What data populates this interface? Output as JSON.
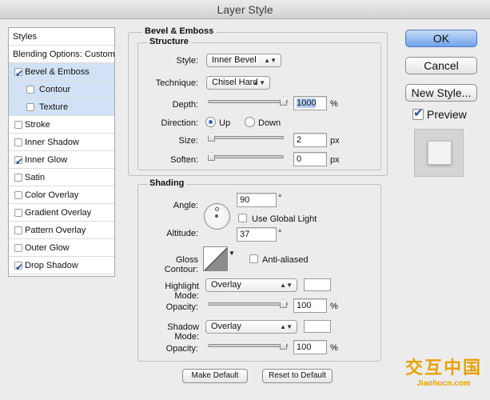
{
  "window": {
    "title": "Layer Style"
  },
  "left_panel": {
    "header": "Styles",
    "blending": "Blending Options: Custom",
    "items": [
      {
        "label": "Bevel & Emboss",
        "checked": true,
        "selected": true,
        "indent": false
      },
      {
        "label": "Contour",
        "checked": false,
        "selected": true,
        "indent": true
      },
      {
        "label": "Texture",
        "checked": false,
        "selected": true,
        "indent": true
      },
      {
        "label": "Stroke",
        "checked": false,
        "selected": false,
        "indent": false
      },
      {
        "label": "Inner Shadow",
        "checked": false,
        "selected": false,
        "indent": false
      },
      {
        "label": "Inner Glow",
        "checked": true,
        "selected": false,
        "indent": false
      },
      {
        "label": "Satin",
        "checked": false,
        "selected": false,
        "indent": false
      },
      {
        "label": "Color Overlay",
        "checked": false,
        "selected": false,
        "indent": false
      },
      {
        "label": "Gradient Overlay",
        "checked": false,
        "selected": false,
        "indent": false
      },
      {
        "label": "Pattern Overlay",
        "checked": false,
        "selected": false,
        "indent": false
      },
      {
        "label": "Outer Glow",
        "checked": false,
        "selected": false,
        "indent": false
      },
      {
        "label": "Drop Shadow",
        "checked": true,
        "selected": false,
        "indent": false
      }
    ]
  },
  "buttons": {
    "ok": "OK",
    "cancel": "Cancel",
    "new_style": "New Style...",
    "preview": "Preview"
  },
  "bevel": {
    "section": "Bevel & Emboss",
    "structure": "Structure",
    "style_label": "Style:",
    "style_value": "Inner Bevel",
    "technique_label": "Technique:",
    "technique_value": "Chisel Hard",
    "depth_label": "Depth:",
    "depth_value": "1000",
    "depth_unit": "%",
    "direction_label": "Direction:",
    "dir_up": "Up",
    "dir_down": "Down",
    "size_label": "Size:",
    "size_value": "2",
    "size_unit": "px",
    "soften_label": "Soften:",
    "soften_value": "0",
    "soften_unit": "px"
  },
  "shading": {
    "section": "Shading",
    "angle_label": "Angle:",
    "angle_value": "90",
    "angle_unit": "°",
    "global_light": "Use Global Light",
    "altitude_label": "Altitude:",
    "altitude_value": "37",
    "altitude_unit": "°",
    "gloss_label": "Gloss Contour:",
    "anti_aliased": "Anti-aliased",
    "highlight_label": "Highlight Mode:",
    "highlight_value": "Overlay",
    "highlight_opacity_label": "Opacity:",
    "highlight_opacity": "100",
    "pct": "%",
    "shadow_label": "Shadow Mode:",
    "shadow_value": "Overlay",
    "shadow_opacity_label": "Opacity:",
    "shadow_opacity": "100"
  },
  "footer": {
    "make_default": "Make Default",
    "reset_default": "Reset to Default"
  },
  "watermark": {
    "top": "交互中国",
    "bottom": "Jiaohucn.com"
  },
  "colors": {
    "accent": "#6fa3e8",
    "selected_row": "#d2e2f6",
    "watermark": "#e8a200"
  }
}
